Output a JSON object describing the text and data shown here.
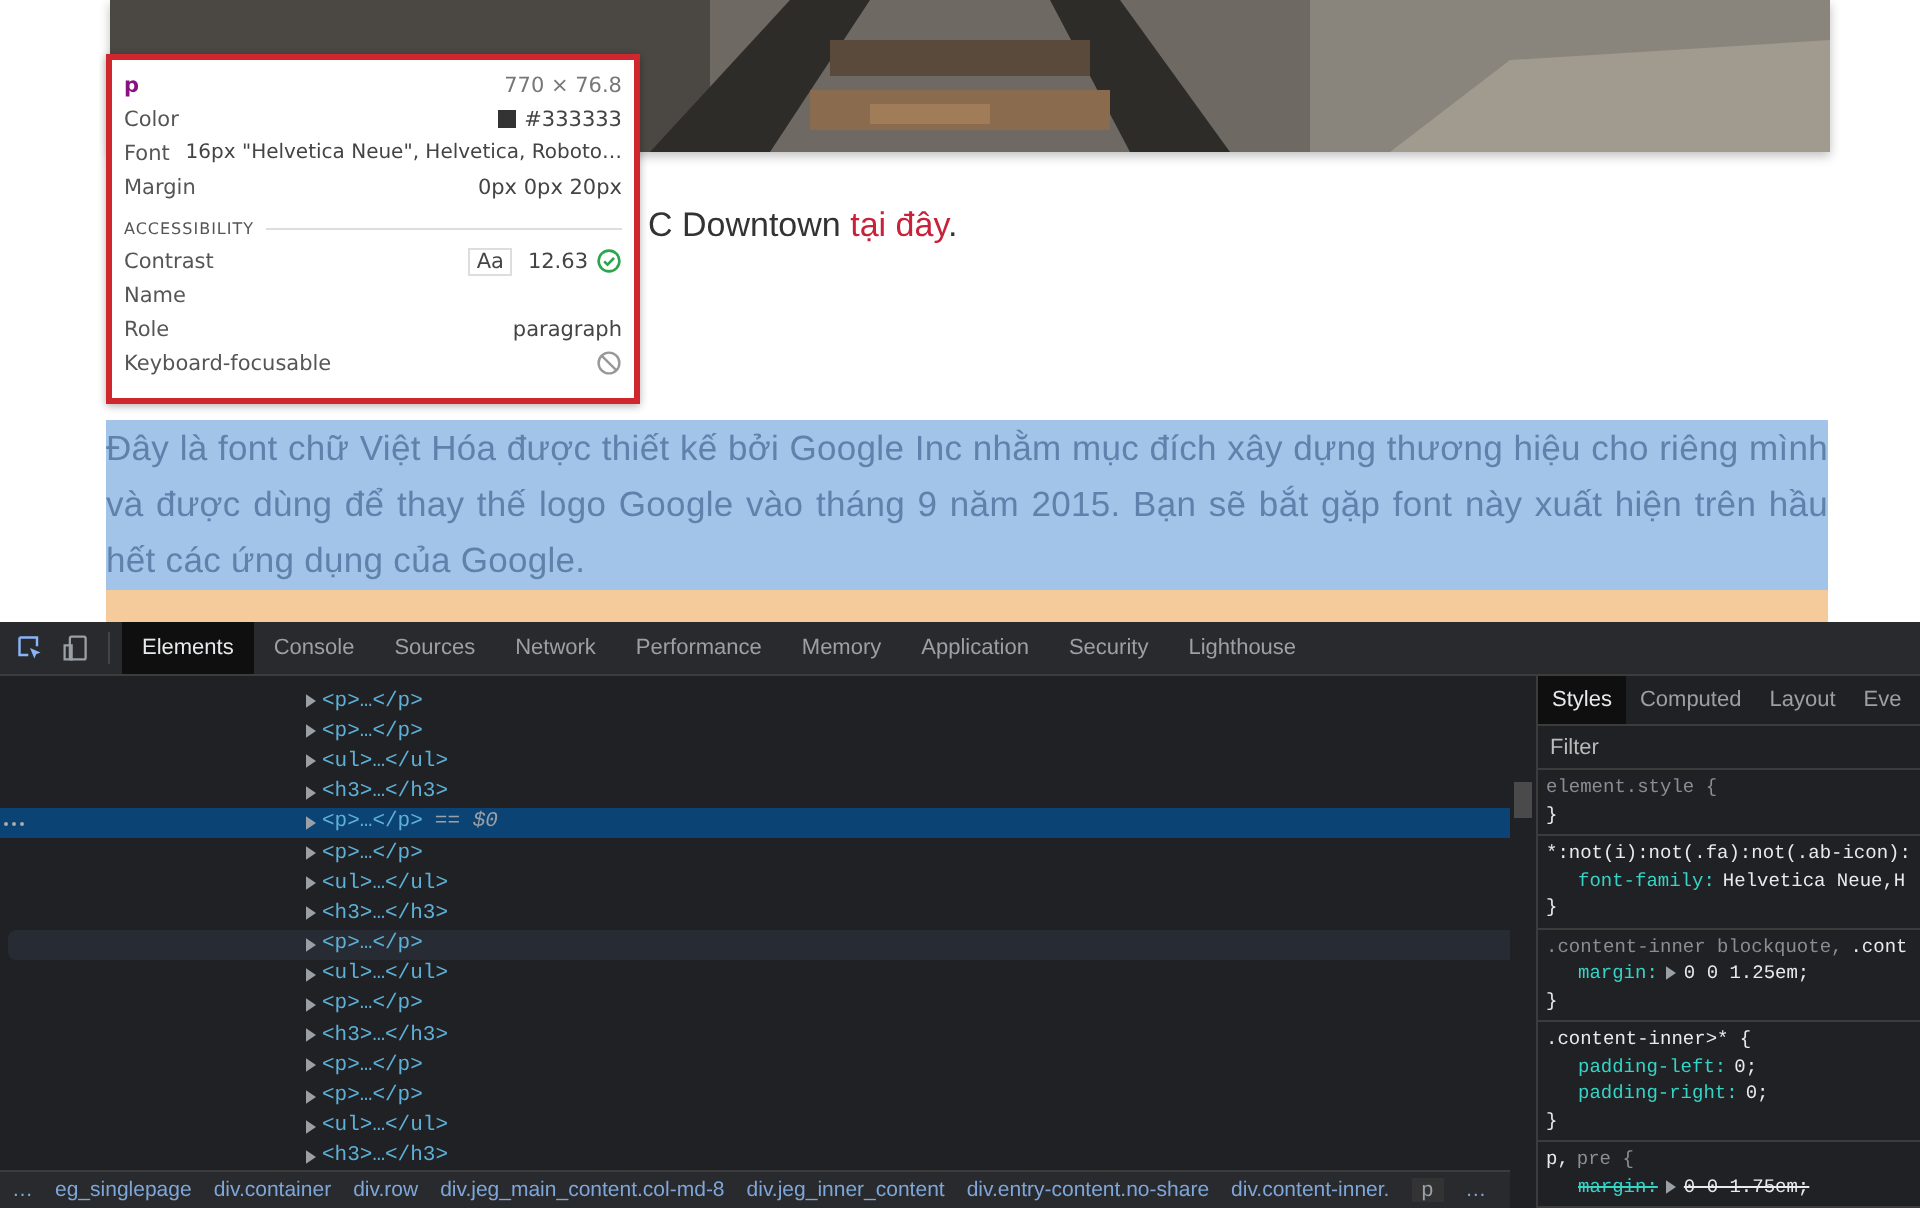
{
  "page": {
    "fragment": {
      "text": "C Downtown ",
      "link": "tại đây",
      "tail": "."
    },
    "highlighted_paragraph": "Đây là font chữ Việt Hóa được thiết kế bởi Google Inc nhằm mục đích xây dựng thương hiệu cho riêng mình và được dùng để thay thế logo Google vào tháng 9 năm 2015. Bạn sẽ bắt gặp font này xuất hiện trên hầu hết các ứng dụng của Google."
  },
  "tooltip": {
    "tag": "p",
    "size": "770 × 76.8",
    "color": {
      "label": "Color",
      "value": "#333333"
    },
    "font": {
      "label": "Font",
      "value": "16px \"Helvetica Neue\", Helvetica, Roboto…"
    },
    "margin": {
      "label": "Margin",
      "value": "0px 0px 20px"
    },
    "section": "ACCESSIBILITY",
    "contrast": {
      "label": "Contrast",
      "badge": "Aa",
      "value": "12.63",
      "passes": true
    },
    "name": {
      "label": "Name"
    },
    "role": {
      "label": "Role",
      "value": "paragraph"
    },
    "keyboard": {
      "label": "Keyboard-focusable",
      "focusable": false
    }
  },
  "devtools": {
    "tabs": [
      {
        "label": "Elements",
        "selected": true
      },
      {
        "label": "Console",
        "selected": false
      },
      {
        "label": "Sources",
        "selected": false
      },
      {
        "label": "Network",
        "selected": false
      },
      {
        "label": "Performance",
        "selected": false
      },
      {
        "label": "Memory",
        "selected": false
      },
      {
        "label": "Application",
        "selected": false
      },
      {
        "label": "Security",
        "selected": false
      },
      {
        "label": "Lighthouse",
        "selected": false
      }
    ],
    "nodes": [
      {
        "text": "<p>…</p>",
        "selected": false,
        "hovered": false
      },
      {
        "text": "<p>…</p>",
        "selected": false,
        "hovered": false
      },
      {
        "text": "<ul>…</ul>",
        "selected": false,
        "hovered": false
      },
      {
        "text": "<h3>…</h3>",
        "selected": false,
        "hovered": false
      },
      {
        "text": "<p>…</p>",
        "selected": true,
        "hovered": false,
        "suffix": "== $0"
      },
      {
        "text": "<p>…</p>",
        "selected": false,
        "hovered": false
      },
      {
        "text": "<ul>…</ul>",
        "selected": false,
        "hovered": false
      },
      {
        "text": "<h3>…</h3>",
        "selected": false,
        "hovered": false
      },
      {
        "text": "<p>…</p>",
        "selected": false,
        "hovered": true
      },
      {
        "text": "<ul>…</ul>",
        "selected": false,
        "hovered": false
      },
      {
        "text": "<p>…</p>",
        "selected": false,
        "hovered": false
      },
      {
        "text": "<h3>…</h3>",
        "selected": false,
        "hovered": false
      },
      {
        "text": "<p>…</p>",
        "selected": false,
        "hovered": false
      },
      {
        "text": "<p>…</p>",
        "selected": false,
        "hovered": false
      },
      {
        "text": "<ul>…</ul>",
        "selected": false,
        "hovered": false
      },
      {
        "text": "<h3>…</h3>",
        "selected": false,
        "hovered": false
      }
    ],
    "breadcrumbs": [
      {
        "label": "…",
        "selected": false
      },
      {
        "label": "eg_singlepage",
        "selected": false
      },
      {
        "label": "div.container",
        "selected": false
      },
      {
        "label": "div.row",
        "selected": false
      },
      {
        "label": "div.jeg_main_content.col-md-8",
        "selected": false
      },
      {
        "label": "div.jeg_inner_content",
        "selected": false
      },
      {
        "label": "div.entry-content.no-share",
        "selected": false
      },
      {
        "label": "div.content-inner.",
        "selected": false
      },
      {
        "label": "p",
        "selected": true
      },
      {
        "label": "…",
        "selected": false
      }
    ],
    "side_tabs": [
      {
        "label": "Styles",
        "selected": true
      },
      {
        "label": "Computed",
        "selected": false
      },
      {
        "label": "Layout",
        "selected": false
      },
      {
        "label": "Eve",
        "selected": false
      }
    ],
    "filter": {
      "placeholder": "Filter"
    },
    "rules": [
      {
        "selector": [
          {
            "text": "element.style {",
            "dim": true
          }
        ],
        "close": "}"
      },
      {
        "selector": [
          {
            "text": "*:not(i):not(.fa):not(.ab-icon):",
            "dim": false
          }
        ],
        "properties": [
          {
            "name": "font-family:",
            "value": "Helvetica Neue,H",
            "expandable": false,
            "struck": false
          }
        ],
        "close": "}"
      },
      {
        "selector": [
          {
            "text": ".content-inner blockquote,",
            "dim": true
          },
          {
            "text": ".cont",
            "dim": false
          }
        ],
        "properties": [
          {
            "name": "margin:",
            "value": "0 0 1.25em;",
            "expandable": true,
            "struck": false
          }
        ],
        "close": "}"
      },
      {
        "selector": [
          {
            "text": ".content-inner>* {",
            "dim": false
          }
        ],
        "properties": [
          {
            "name": "padding-left:",
            "value": "0;",
            "expandable": false,
            "struck": false
          },
          {
            "name": "padding-right:",
            "value": "0;",
            "expandable": false,
            "struck": false
          }
        ],
        "close": "}"
      },
      {
        "selector": [
          {
            "text": "p,",
            "dim": false
          },
          {
            "text": "pre {",
            "dim": true
          }
        ],
        "properties": [
          {
            "name": "margin:",
            "value": "0 0 1.75em;",
            "expandable": true,
            "struck": true
          }
        ]
      }
    ]
  }
}
